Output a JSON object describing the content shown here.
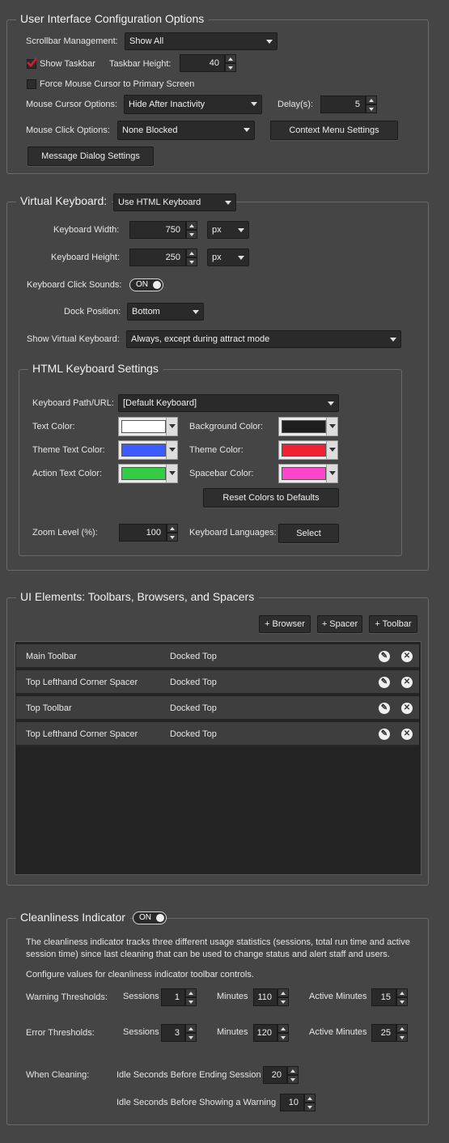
{
  "ui_config": {
    "title": "User Interface Configuration Options",
    "scrollbar_label": "Scrollbar Management:",
    "scrollbar_value": "Show All",
    "show_taskbar_label": "Show Taskbar",
    "taskbar_height_label": "Taskbar Height:",
    "taskbar_height_value": "40",
    "force_mouse_label": "Force Mouse Cursor to Primary Screen",
    "mouse_cursor_label": "Mouse Cursor Options:",
    "mouse_cursor_value": "Hide After Inactivity",
    "delay_label": "Delay(s):",
    "delay_value": "5",
    "mouse_click_label": "Mouse Click Options:",
    "mouse_click_value": "None Blocked",
    "context_menu_button": "Context Menu Settings",
    "message_dialog_button": "Message Dialog Settings"
  },
  "virtual_keyboard": {
    "title": "Virtual Keyboard:",
    "type_value": "Use HTML Keyboard",
    "width_label": "Keyboard Width:",
    "width_value": "750",
    "width_unit": "px",
    "height_label": "Keyboard Height:",
    "height_value": "250",
    "height_unit": "px",
    "click_sounds_label": "Keyboard Click Sounds:",
    "click_sounds_toggle": "ON",
    "dock_label": "Dock Position:",
    "dock_value": "Bottom",
    "show_label": "Show Virtual Keyboard:",
    "show_value": "Always, except during attract mode"
  },
  "html_keyboard": {
    "title": "HTML Keyboard Settings",
    "path_label": "Keyboard Path/URL:",
    "path_value": "[Default Keyboard]",
    "text_color_label": "Text Color:",
    "background_color_label": "Background Color:",
    "theme_text_color_label": "Theme Text Color:",
    "theme_color_label": "Theme Color:",
    "action_text_color_label": "Action Text Color:",
    "spacebar_color_label": "Spacebar Color:",
    "colors": {
      "text": "#ffffff",
      "background": "#1e1e1e",
      "theme_text": "#3d5cff",
      "theme": "#ee2233",
      "action_text": "#33cc44",
      "spacebar": "#ff44cc"
    },
    "reset_button": "Reset Colors to Defaults",
    "zoom_label": "Zoom Level (%):",
    "zoom_value": "100",
    "languages_label": "Keyboard Languages:",
    "select_button": "Select"
  },
  "ui_elements": {
    "title": "UI Elements: Toolbars, Browsers, and Spacers",
    "add_browser": "+ Browser",
    "add_spacer": "+ Spacer",
    "add_toolbar": "+ Toolbar",
    "rows": [
      {
        "name": "Main Toolbar",
        "dock": "Docked Top"
      },
      {
        "name": "Top Lefthand Corner Spacer",
        "dock": "Docked Top"
      },
      {
        "name": "Top Toolbar",
        "dock": "Docked Top"
      },
      {
        "name": "Top Lefthand Corner Spacer",
        "dock": "Docked Top"
      }
    ],
    "edit_icon": "edit-icon",
    "remove_icon": "close-icon"
  },
  "cleanliness": {
    "title": "Cleanliness Indicator",
    "toggle": "ON",
    "description": "The cleanliness indicator tracks three different usage statistics (sessions, total run time and active session time) since last cleaning that can be used to change status and alert staff and users.",
    "configure_text": "Configure values for cleanliness indicator toolbar controls.",
    "warning_label": "Warning Thresholds:",
    "error_label": "Error Thresholds:",
    "sessions_label": "Sessions",
    "minutes_label": "Minutes",
    "active_minutes_label": "Active Minutes",
    "warning_sessions": "1",
    "warning_minutes": "110",
    "warning_active": "15",
    "error_sessions": "3",
    "error_minutes": "120",
    "error_active": "25",
    "when_cleaning_label": "When Cleaning:",
    "idle_end_label": "Idle Seconds Before Ending Session",
    "idle_end_value": "20",
    "idle_warn_label": "Idle Seconds Before Showing a Warning",
    "idle_warn_value": "10"
  }
}
